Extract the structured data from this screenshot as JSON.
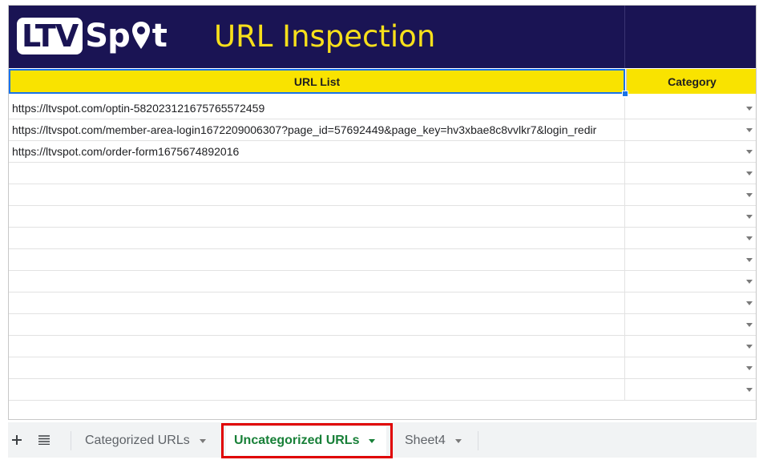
{
  "banner": {
    "logo_ltv": "LTV",
    "logo_sp": "Sp",
    "logo_t": "t",
    "title": "URL Inspection"
  },
  "headers": {
    "url_list": "URL List",
    "category": "Category"
  },
  "rows": [
    {
      "url": "https://ltvspot.com/optin-582023121675765572459",
      "category": ""
    },
    {
      "url": "https://ltvspot.com/member-area-login1672209006307?page_id=57692449&page_key=hv3xbae8c8vvlkr7&login_redir",
      "category": ""
    },
    {
      "url": "https://ltvspot.com/order-form1675674892016",
      "category": ""
    },
    {
      "url": "",
      "category": ""
    },
    {
      "url": "",
      "category": ""
    },
    {
      "url": "",
      "category": ""
    },
    {
      "url": "",
      "category": ""
    },
    {
      "url": "",
      "category": ""
    },
    {
      "url": "",
      "category": ""
    },
    {
      "url": "",
      "category": ""
    },
    {
      "url": "",
      "category": ""
    },
    {
      "url": "",
      "category": ""
    },
    {
      "url": "",
      "category": ""
    },
    {
      "url": "",
      "category": ""
    }
  ],
  "tabs": [
    {
      "label": "Categorized URLs",
      "active": false
    },
    {
      "label": "Uncategorized URLs",
      "active": true
    },
    {
      "label": "Sheet4",
      "active": false
    }
  ],
  "icons": {
    "add": "plus-icon",
    "all_sheets": "menu-lines-icon",
    "dropdown": "triangle-down-icon"
  },
  "colors": {
    "banner": "#1a14544",
    "title": "#f7e01b",
    "header": "#f9e300",
    "active_tab": "#188038",
    "highlight": "#e00000"
  }
}
